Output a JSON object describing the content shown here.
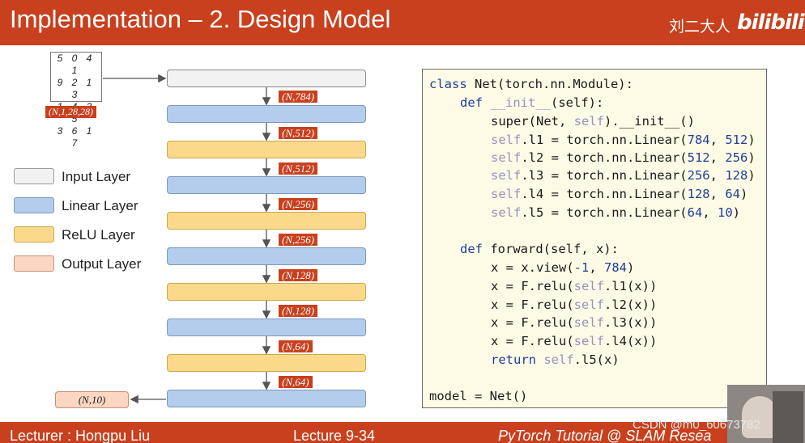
{
  "header": {
    "title": "Implementation – 2. Design Model",
    "brand": "刘二大人",
    "logo": "bilibili"
  },
  "footer": {
    "lecturer": "Lecturer : Hongpu Liu",
    "lecture": "Lecture 9-34",
    "tutorial": "PyTorch Tutorial @ SLAM Resea"
  },
  "watermark": "CSDN @m0_60673782",
  "input_image": {
    "rows": [
      "5 0 4 1",
      "9 2 1 3",
      "1 4 3 5",
      "3 6 1 7"
    ],
    "shape": "(N,1,28,28)"
  },
  "output_shape": "(N,10)",
  "shapes": [
    "(N,784)",
    "(N,512)",
    "(N,512)",
    "(N,256)",
    "(N,256)",
    "(N,128)",
    "(N,128)",
    "(N,64)",
    "(N,64)"
  ],
  "legend": [
    {
      "label": "Input Layer",
      "color": "#f2f2f2"
    },
    {
      "label": "Linear Layer",
      "color": "#b4cdec"
    },
    {
      "label": "ReLU Layer",
      "color": "#fbd98a"
    },
    {
      "label": "Output Layer",
      "color": "#fbd6c2"
    }
  ],
  "colors": {
    "accent": "#c8401e",
    "annotation": "#e0101a"
  },
  "code": {
    "l1": {
      "kw": "class",
      "rest": " Net(torch.nn.Module):"
    },
    "l2": {
      "kw": "def",
      "fn": " __init__",
      "rest": "(self):"
    },
    "l3": {
      "a": "super(Net, ",
      "b": "self",
      "c": ").__init__()"
    },
    "linears": [
      {
        "s": "self",
        "r": ".l1 = torch.nn.Linear(",
        "a": "784",
        "c": ", ",
        "b": "512",
        "e": ")"
      },
      {
        "s": "self",
        "r": ".l2 = torch.nn.Linear(",
        "a": "512",
        "c": ", ",
        "b": "256",
        "e": ")"
      },
      {
        "s": "self",
        "r": ".l3 = torch.nn.Linear(",
        "a": "256",
        "c": ", ",
        "b": "128",
        "e": ")"
      },
      {
        "s": "self",
        "r": ".l4 = torch.nn.Linear(",
        "a": "128",
        "c": ", ",
        "b": "64",
        "e": ")"
      },
      {
        "s": "self",
        "r": ".l5 = torch.nn.Linear(",
        "a": "64",
        "c": ", ",
        "b": "10",
        "e": ")"
      }
    ],
    "l9": {
      "kw": "def",
      "rest": " forward(self, x):"
    },
    "l10": {
      "a": "x = x.view(",
      "b": "-1",
      "c": ", ",
      "d": "784",
      "e": ")"
    },
    "relus": [
      {
        "a": "x = F.relu(",
        "s": "self",
        "r": ".l1(x))"
      },
      {
        "a": "x = F.relu(",
        "s": "self",
        "r": ".l2(x))"
      },
      {
        "a": "x = F.relu(",
        "s": "self",
        "r": ".l3(x))"
      },
      {
        "a": "x = F.relu(",
        "s": "self",
        "r": ".l4(x))"
      }
    ],
    "l15": {
      "kw": "return",
      "s": " self",
      "r": ".l5(x)"
    },
    "l16": {
      "a": "model = Net()"
    }
  }
}
